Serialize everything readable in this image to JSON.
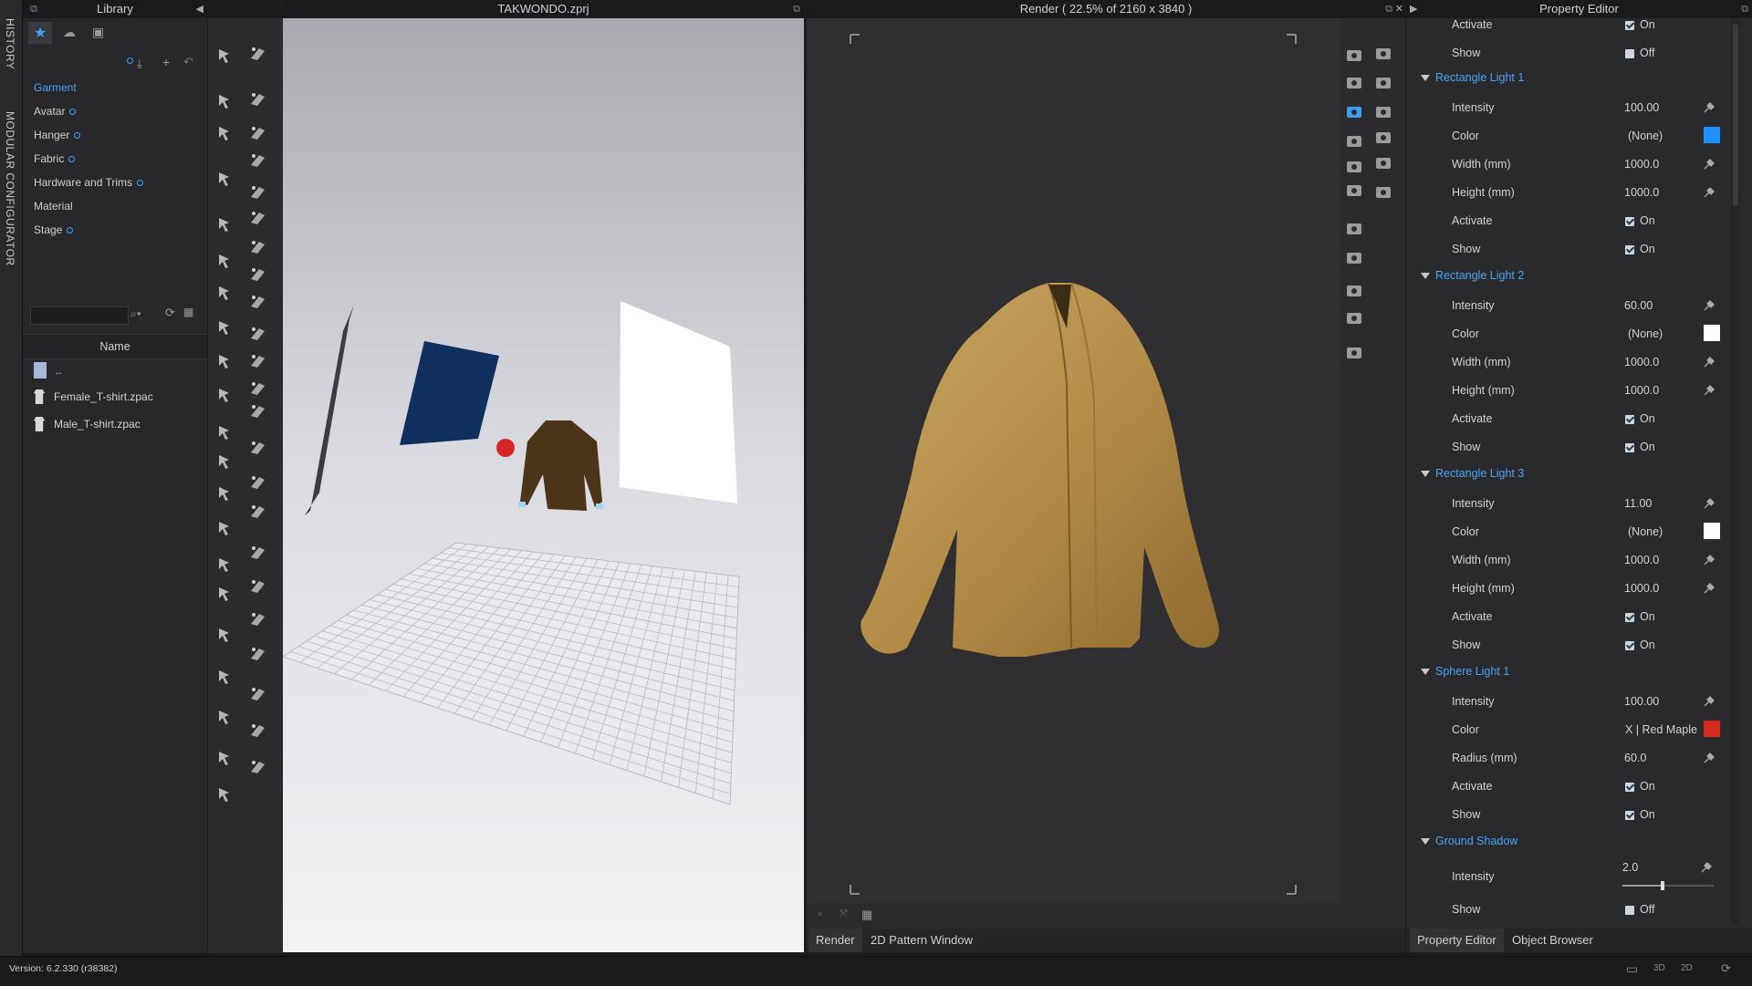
{
  "history_strip": {
    "history_label": "HISTORY",
    "configurator_label": "MODULAR CONFIGURATOR"
  },
  "library": {
    "title": "Library",
    "categories": [
      {
        "label": "Garment",
        "selected": true,
        "dot": false
      },
      {
        "label": "Avatar",
        "selected": false,
        "dot": true
      },
      {
        "label": "Hanger",
        "selected": false,
        "dot": true
      },
      {
        "label": "Fabric",
        "selected": false,
        "dot": true
      },
      {
        "label": "Hardware and Trims",
        "selected": false,
        "dot": true
      },
      {
        "label": "Material",
        "selected": false,
        "dot": false
      },
      {
        "label": "Stage",
        "selected": false,
        "dot": true
      }
    ],
    "search": {
      "placeholder": ""
    },
    "column_header": "Name",
    "files": [
      {
        "name": "..",
        "icon": "folder-up-icon"
      },
      {
        "name": "Female_T-shirt.zpac",
        "icon": "tshirt-icon"
      },
      {
        "name": "Male_T-shirt.zpac",
        "icon": "tshirt-icon"
      }
    ]
  },
  "viewport3d": {
    "title": "TAKWONDO.zprj"
  },
  "render": {
    "title": "Render ( 22.5% of 2160 x 3840 )",
    "bottom_tabs": [
      "Render",
      "2D Pattern Window"
    ]
  },
  "property_editor": {
    "title": "Property Editor",
    "top_rows": [
      {
        "label": "Activate",
        "value": "On",
        "checked": true
      },
      {
        "label": "Show",
        "value": "Off",
        "checked": false
      }
    ],
    "sections": [
      {
        "name": "Rectangle Light 1",
        "rows": [
          {
            "label": "Intensity",
            "value": "100.00",
            "kind": "num"
          },
          {
            "label": "Color",
            "value": "(None)",
            "kind": "color",
            "color": "#1e90ff"
          },
          {
            "label": "Width (mm)",
            "value": "1000.0",
            "kind": "num"
          },
          {
            "label": "Height (mm)",
            "value": "1000.0",
            "kind": "num"
          },
          {
            "label": "Activate",
            "value": "On",
            "kind": "check",
            "checked": true
          },
          {
            "label": "Show",
            "value": "On",
            "kind": "check",
            "checked": true
          }
        ]
      },
      {
        "name": "Rectangle Light 2",
        "rows": [
          {
            "label": "Intensity",
            "value": "60.00",
            "kind": "num"
          },
          {
            "label": "Color",
            "value": "(None)",
            "kind": "color",
            "color": "#ffffff"
          },
          {
            "label": "Width (mm)",
            "value": "1000.0",
            "kind": "num"
          },
          {
            "label": "Height (mm)",
            "value": "1000.0",
            "kind": "num"
          },
          {
            "label": "Activate",
            "value": "On",
            "kind": "check",
            "checked": true
          },
          {
            "label": "Show",
            "value": "On",
            "kind": "check",
            "checked": true
          }
        ]
      },
      {
        "name": "Rectangle Light 3",
        "rows": [
          {
            "label": "Intensity",
            "value": "11.00",
            "kind": "num"
          },
          {
            "label": "Color",
            "value": "(None)",
            "kind": "color",
            "color": "#ffffff"
          },
          {
            "label": "Width (mm)",
            "value": "1000.0",
            "kind": "num"
          },
          {
            "label": "Height (mm)",
            "value": "1000.0",
            "kind": "num"
          },
          {
            "label": "Activate",
            "value": "On",
            "kind": "check",
            "checked": true
          },
          {
            "label": "Show",
            "value": "On",
            "kind": "check",
            "checked": true
          }
        ]
      },
      {
        "name": "Sphere Light 1",
        "rows": [
          {
            "label": "Intensity",
            "value": "100.00",
            "kind": "num"
          },
          {
            "label": "Color",
            "value": "X | Red Maple",
            "kind": "color",
            "color": "#d42a1e"
          },
          {
            "label": "Radius (mm)",
            "value": "60.0",
            "kind": "num"
          },
          {
            "label": "Activate",
            "value": "On",
            "kind": "check",
            "checked": true
          },
          {
            "label": "Show",
            "value": "On",
            "kind": "check",
            "checked": true
          }
        ]
      },
      {
        "name": "Ground Shadow",
        "rows": [
          {
            "label": "Intensity",
            "value": "2.0",
            "kind": "slider",
            "level": 0.42
          },
          {
            "label": "Show",
            "value": "Off",
            "kind": "check",
            "checked": false
          }
        ]
      }
    ],
    "bottom_tabs": [
      "Property Editor",
      "Object Browser"
    ]
  },
  "status": {
    "version": "Version: 6.2.330 (r38382)"
  }
}
